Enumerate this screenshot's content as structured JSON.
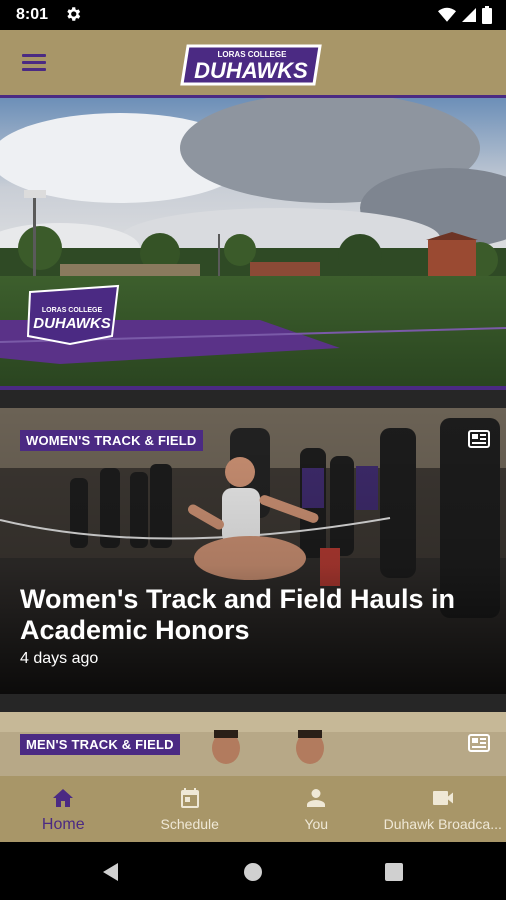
{
  "status_bar": {
    "time": "8:01",
    "icons": [
      "settings-gear-icon",
      "wifi-icon",
      "signal-icon",
      "battery-icon"
    ]
  },
  "header": {
    "logo_line1": "LORAS COLLEGE",
    "logo_line2": "DUHAWKS",
    "menu_icon": "hamburger-menu-icon"
  },
  "hero": {
    "logo_line1": "LORAS COLLEGE",
    "logo_line2": "DUHAWKS"
  },
  "cards": [
    {
      "category": "WOMEN'S TRACK & FIELD",
      "title": "Women's Track and Field Hauls in Academic Honors",
      "time": "4 days ago",
      "icon": "news-article-icon"
    },
    {
      "category": "MEN'S TRACK & FIELD",
      "icon": "news-article-icon"
    }
  ],
  "bottom_nav": {
    "items": [
      {
        "label": "Home",
        "icon": "home-icon",
        "active": true
      },
      {
        "label": "Schedule",
        "icon": "calendar-icon",
        "active": false
      },
      {
        "label": "You",
        "icon": "person-icon",
        "active": false
      },
      {
        "label": "Duhawk Broadca...",
        "icon": "video-camera-icon",
        "active": false
      }
    ]
  },
  "colors": {
    "gold": "#a89668",
    "purple": "#4b2a83",
    "nav_label": "#efe8d6"
  }
}
